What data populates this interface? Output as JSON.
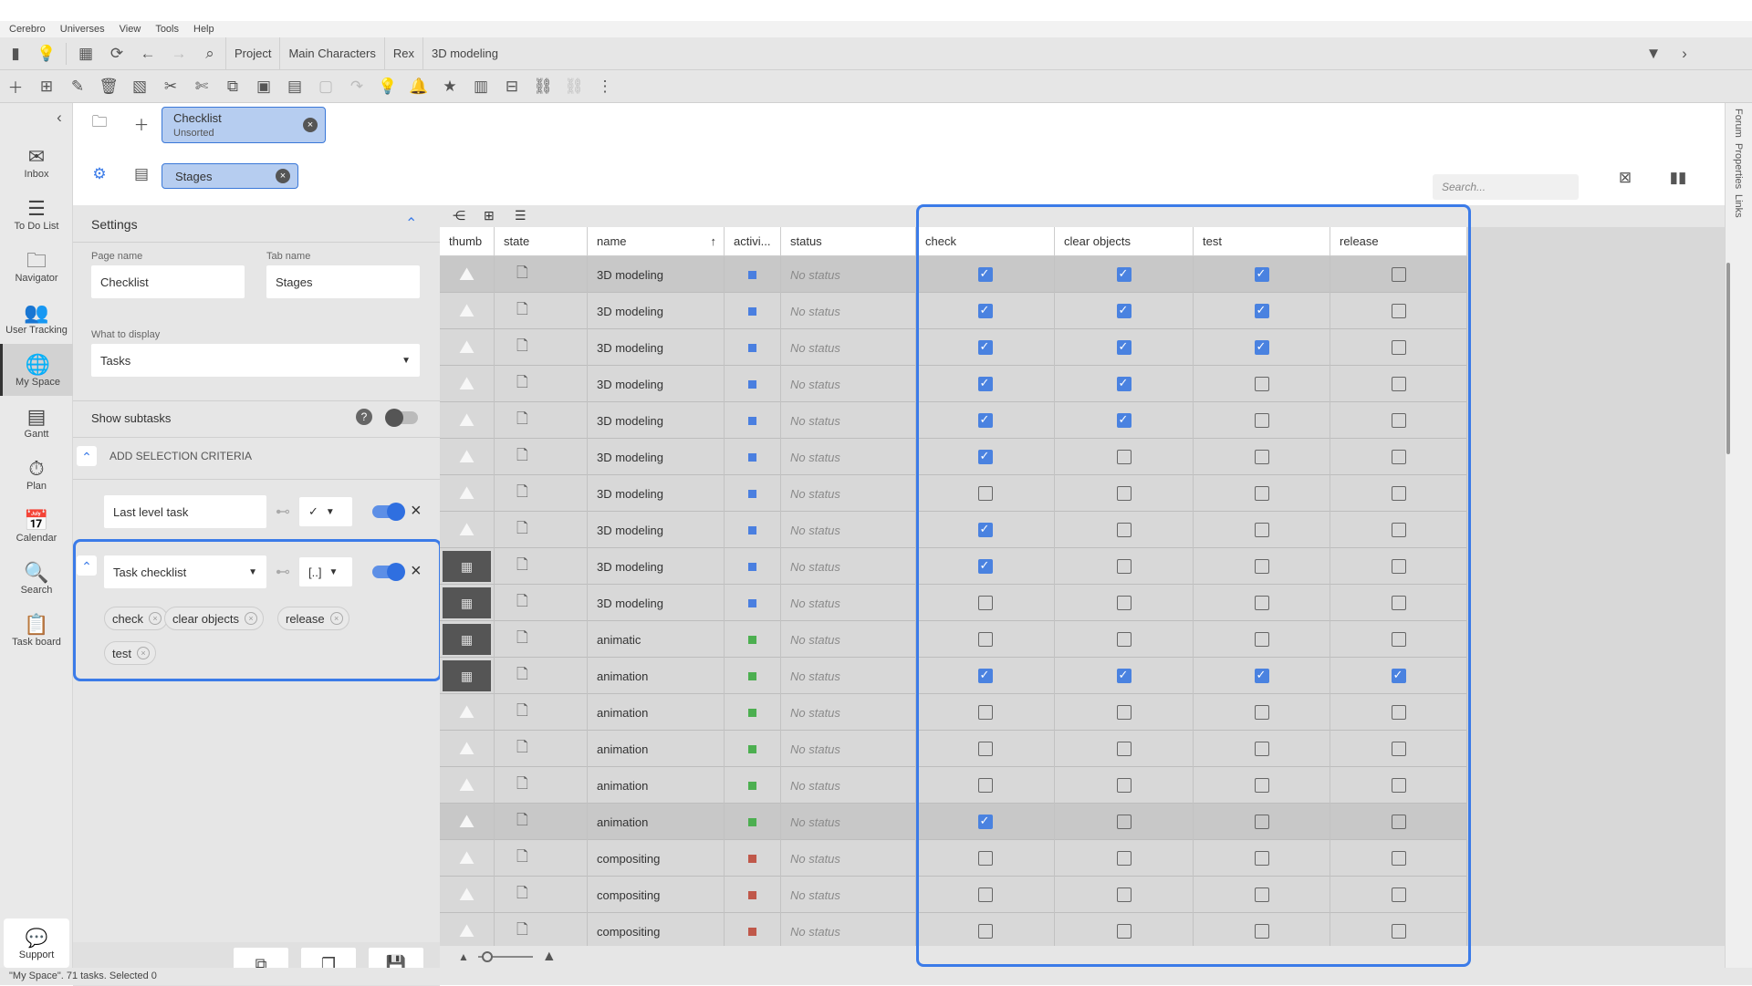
{
  "menu": [
    "Cerebro",
    "Universes",
    "View",
    "Tools",
    "Help"
  ],
  "breadcrumbs": [
    "Project",
    "Main Characters",
    "Rex",
    "3D modeling"
  ],
  "nav": [
    {
      "label": "Inbox",
      "icon": "✉"
    },
    {
      "label": "To Do List",
      "icon": "☰"
    },
    {
      "label": "Navigator",
      "icon": "🗀"
    },
    {
      "label": "User Tracking",
      "icon": "👥"
    },
    {
      "label": "My Space",
      "icon": "🌐"
    },
    {
      "label": "Gantt",
      "icon": "▤"
    },
    {
      "label": "Plan",
      "icon": "⏱"
    },
    {
      "label": "Calendar",
      "icon": "📅"
    },
    {
      "label": "Search",
      "icon": "🔍"
    },
    {
      "label": "Task board",
      "icon": "📋"
    }
  ],
  "support_label": "Support",
  "tabs": {
    "page_chip_title": "Checklist",
    "page_chip_sub": "Unsorted",
    "tab_chip": "Stages",
    "search_placeholder": "Search..."
  },
  "settings": {
    "title": "Settings",
    "page_name_label": "Page name",
    "page_name_value": "Checklist",
    "tab_name_label": "Tab name",
    "tab_name_value": "Stages",
    "display_label": "What to display",
    "display_value": "Tasks",
    "subtasks_label": "Show subtasks",
    "criteria_label": "ADD SELECTION CRITERIA",
    "criterion1": "Last level task",
    "criterion2": "Task checklist",
    "criterion2_op": "[..]",
    "tags": [
      "check",
      "clear objects",
      "release",
      "test"
    ]
  },
  "right_rail": [
    "Forum",
    "Properties",
    "Links"
  ],
  "columns": [
    "thumb",
    "state",
    "name",
    "activi...",
    "status",
    "check",
    "clear objects",
    "test",
    "release"
  ],
  "rows": [
    {
      "name": "3D modeling",
      "act": "#4a7fe0",
      "status": "No status",
      "checks": [
        true,
        true,
        true,
        false
      ],
      "sel": true,
      "thumb": "ph"
    },
    {
      "name": "3D modeling",
      "act": "#4a7fe0",
      "status": "No status",
      "checks": [
        true,
        true,
        true,
        false
      ],
      "sel": false,
      "thumb": "ph"
    },
    {
      "name": "3D modeling",
      "act": "#4a7fe0",
      "status": "No status",
      "checks": [
        true,
        true,
        true,
        false
      ],
      "sel": false,
      "thumb": "ph"
    },
    {
      "name": "3D modeling",
      "act": "#4a7fe0",
      "status": "No status",
      "checks": [
        true,
        true,
        false,
        false
      ],
      "sel": false,
      "thumb": "ph"
    },
    {
      "name": "3D modeling",
      "act": "#4a7fe0",
      "status": "No status",
      "checks": [
        true,
        true,
        false,
        false
      ],
      "sel": false,
      "thumb": "ph"
    },
    {
      "name": "3D modeling",
      "act": "#4a7fe0",
      "status": "No status",
      "checks": [
        true,
        false,
        false,
        false
      ],
      "sel": false,
      "thumb": "ph"
    },
    {
      "name": "3D modeling",
      "act": "#4a7fe0",
      "status": "No status",
      "checks": [
        false,
        false,
        false,
        false
      ],
      "sel": false,
      "thumb": "ph"
    },
    {
      "name": "3D modeling",
      "act": "#4a7fe0",
      "status": "No status",
      "checks": [
        true,
        false,
        false,
        false
      ],
      "sel": false,
      "thumb": "ph"
    },
    {
      "name": "3D modeling",
      "act": "#4a7fe0",
      "status": "No status",
      "checks": [
        true,
        false,
        false,
        false
      ],
      "sel": false,
      "thumb": "img"
    },
    {
      "name": "3D modeling",
      "act": "#4a7fe0",
      "status": "No status",
      "checks": [
        false,
        false,
        false,
        false
      ],
      "sel": false,
      "thumb": "img"
    },
    {
      "name": "animatic",
      "act": "#4caf50",
      "status": "No status",
      "checks": [
        false,
        false,
        false,
        false
      ],
      "sel": false,
      "thumb": "img"
    },
    {
      "name": "animation",
      "act": "#4caf50",
      "status": "No status",
      "checks": [
        true,
        true,
        true,
        true
      ],
      "sel": false,
      "thumb": "img"
    },
    {
      "name": "animation",
      "act": "#4caf50",
      "status": "No status",
      "checks": [
        false,
        false,
        false,
        false
      ],
      "sel": false,
      "thumb": "ph"
    },
    {
      "name": "animation",
      "act": "#4caf50",
      "status": "No status",
      "checks": [
        false,
        false,
        false,
        false
      ],
      "sel": false,
      "thumb": "ph"
    },
    {
      "name": "animation",
      "act": "#4caf50",
      "status": "No status",
      "checks": [
        false,
        false,
        false,
        false
      ],
      "sel": false,
      "thumb": "ph"
    },
    {
      "name": "animation",
      "act": "#4caf50",
      "status": "No status",
      "checks": [
        true,
        false,
        false,
        false
      ],
      "sel": true,
      "thumb": "ph"
    },
    {
      "name": "compositing",
      "act": "#c0584a",
      "status": "No status",
      "checks": [
        false,
        false,
        false,
        false
      ],
      "sel": false,
      "thumb": "ph"
    },
    {
      "name": "compositing",
      "act": "#c0584a",
      "status": "No status",
      "checks": [
        false,
        false,
        false,
        false
      ],
      "sel": false,
      "thumb": "ph"
    },
    {
      "name": "compositing",
      "act": "#c0584a",
      "status": "No status",
      "checks": [
        false,
        false,
        false,
        false
      ],
      "sel": false,
      "thumb": "ph"
    }
  ],
  "statusbar": "\"My Space\". 71 tasks. Selected 0",
  "colors": {
    "accent": "#3b7be8",
    "checkbox_on": "#4a82e0"
  }
}
